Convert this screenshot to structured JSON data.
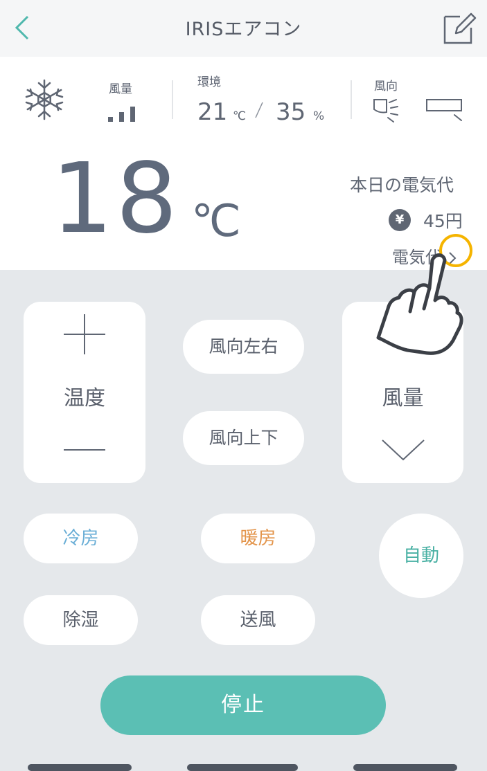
{
  "header": {
    "title": "IRISエアコン"
  },
  "status": {
    "fan_label": "風量",
    "env_label": "環境",
    "env_temp": "21",
    "env_temp_unit": "℃",
    "env_humidity": "35",
    "env_humidity_unit": "%",
    "wind_dir_label": "風向",
    "fan_level": 3
  },
  "setpoint": {
    "value": "18",
    "unit": "℃"
  },
  "cost": {
    "title": "本日の電気代",
    "yen_symbol": "¥",
    "amount": "45円",
    "link_label": "電気代"
  },
  "controls": {
    "temp_label": "温度",
    "swing_lr": "風向左右",
    "swing_ud": "風向上下",
    "fan_label": "風量"
  },
  "modes": {
    "cool": "冷房",
    "heat": "暖房",
    "auto": "自動",
    "dry": "除湿",
    "fan": "送風"
  },
  "stop_label": "停止",
  "colors": {
    "accent_teal": "#5bbfb4",
    "cool_blue": "#6aaed6",
    "heat_orange": "#e3944a",
    "auto_teal": "#48b0a3",
    "highlight": "#f5b400"
  }
}
